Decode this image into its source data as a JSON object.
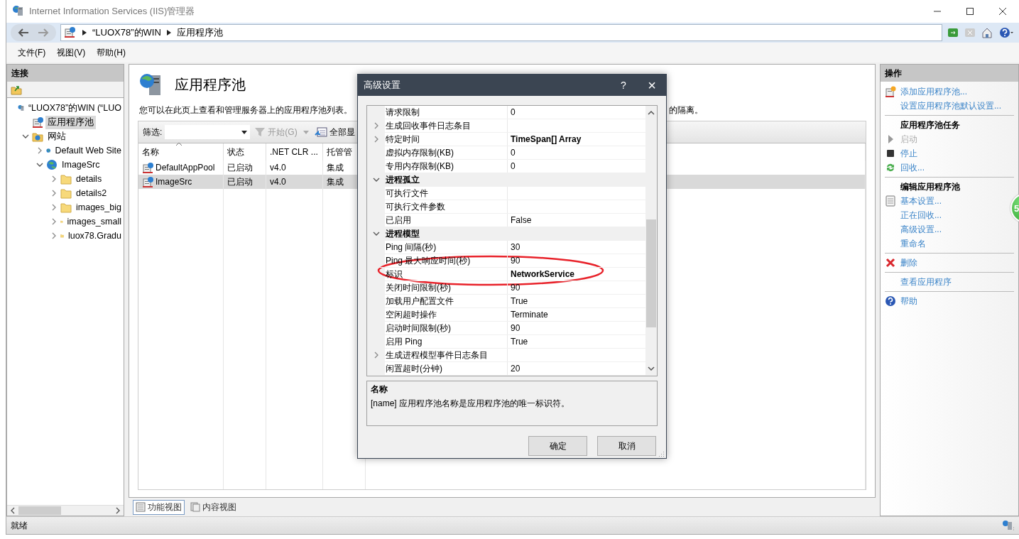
{
  "window": {
    "title": "Internet Information Services (IIS)管理器"
  },
  "address_bar": {
    "crumbs": [
      "“LUOX78”的WIN",
      "应用程序池"
    ]
  },
  "menu": [
    "文件(F)",
    "视图(V)",
    "帮助(H)"
  ],
  "connections": {
    "title": "连接",
    "tree": [
      {
        "label": "“LUOX78”的WIN (“LUO",
        "kind": "server",
        "selected": false,
        "children": [
          {
            "label": "应用程序池",
            "kind": "pool",
            "selected": true
          },
          {
            "label": "网站",
            "kind": "sites",
            "selected": false,
            "expanded": true,
            "children": [
              {
                "label": "Default Web Site",
                "kind": "site",
                "selected": false,
                "expanded": false
              },
              {
                "label": "ImageSrc",
                "kind": "site",
                "selected": false,
                "expanded": true,
                "children": [
                  {
                    "label": "details",
                    "kind": "folder",
                    "selected": false,
                    "expanded": false
                  },
                  {
                    "label": "details2",
                    "kind": "folder",
                    "selected": false,
                    "expanded": false
                  },
                  {
                    "label": "images_big",
                    "kind": "folder",
                    "selected": false,
                    "expanded": false
                  },
                  {
                    "label": "images_small",
                    "kind": "folder",
                    "selected": false,
                    "expanded": false
                  },
                  {
                    "label": "luox78.Gradu",
                    "kind": "folder",
                    "selected": false,
                    "expanded": false
                  }
                ]
              }
            ]
          }
        ]
      }
    ]
  },
  "content": {
    "title": "应用程序池",
    "description": "您可以在此页上查看和管理服务器上的应用程序池列表。",
    "description_tail": "的隔离。",
    "filter": {
      "label": "筛选:",
      "go": "开始(G)",
      "show_all": "全部显"
    },
    "columns": [
      "名称",
      "状态",
      ".NET CLR ...",
      "托管管"
    ],
    "rows": [
      {
        "cells": [
          "DefaultAppPool",
          "已启动",
          "v4.0",
          "集成"
        ],
        "selected": false
      },
      {
        "cells": [
          "ImageSrc",
          "已启动",
          "v4.0",
          "集成"
        ],
        "selected": true
      }
    ],
    "views": [
      {
        "label": "功能视图",
        "selected": true
      },
      {
        "label": "内容视图",
        "selected": false
      }
    ]
  },
  "actions": {
    "title": "操作",
    "items": [
      {
        "kind": "add",
        "text": "添加应用程序池...",
        "disabled": false
      },
      {
        "kind": "link",
        "text": "设置应用程序池默认设置...",
        "disabled": false
      },
      {
        "kind": "separator"
      },
      {
        "kind": "heading",
        "text": "应用程序池任务"
      },
      {
        "kind": "start",
        "text": "启动",
        "disabled": true
      },
      {
        "kind": "stop",
        "text": "停止",
        "disabled": false
      },
      {
        "kind": "recycle",
        "text": "回收...",
        "disabled": false
      },
      {
        "kind": "separator"
      },
      {
        "kind": "heading",
        "text": "编辑应用程序池"
      },
      {
        "kind": "edit",
        "text": "基本设置...",
        "disabled": false
      },
      {
        "kind": "link",
        "text": "正在回收...",
        "disabled": false
      },
      {
        "kind": "link",
        "text": "高级设置...",
        "disabled": false
      },
      {
        "kind": "link",
        "text": "重命名",
        "disabled": false
      },
      {
        "kind": "separator"
      },
      {
        "kind": "delete",
        "text": "删除",
        "disabled": false
      },
      {
        "kind": "separator"
      },
      {
        "kind": "link",
        "text": "查看应用程序",
        "disabled": false
      },
      {
        "kind": "separator"
      },
      {
        "kind": "help",
        "text": "帮助",
        "disabled": false
      }
    ]
  },
  "badge": {
    "text": "5"
  },
  "status_bar": {
    "text": "就绪"
  },
  "dialog": {
    "title": "高级设置",
    "help": "?",
    "close": "×",
    "properties": [
      {
        "kind": "prop",
        "name": "请求限制",
        "value": "0",
        "bold": false
      },
      {
        "kind": "prop",
        "name": "生成回收事件日志条目",
        "expanded": false
      },
      {
        "kind": "prop",
        "name": "特定时间",
        "value": "TimeSpan[] Array",
        "expanded": false,
        "bold": true
      },
      {
        "kind": "prop",
        "name": "虚拟内存限制(KB)",
        "value": "0",
        "bold": false
      },
      {
        "kind": "prop",
        "name": "专用内存限制(KB)",
        "value": "0",
        "bold": false
      },
      {
        "kind": "category",
        "name": "进程孤立",
        "expanded": true
      },
      {
        "kind": "prop",
        "name": "可执行文件"
      },
      {
        "kind": "prop",
        "name": "可执行文件参数"
      },
      {
        "kind": "prop",
        "name": "已启用",
        "value": "False",
        "bold": false
      },
      {
        "kind": "category",
        "name": "进程模型",
        "expanded": true
      },
      {
        "kind": "prop",
        "name": "Ping 间隔(秒)",
        "value": "30",
        "bold": false
      },
      {
        "kind": "prop",
        "name": "Ping 最大响应时间(秒)",
        "value": "90",
        "bold": false
      },
      {
        "kind": "prop",
        "name": "标识",
        "value": "NetworkService",
        "bold": true
      },
      {
        "kind": "prop",
        "name": "关闭时间限制(秒)",
        "value": "90",
        "bold": false
      },
      {
        "kind": "prop",
        "name": "加载用户配置文件",
        "value": "True",
        "bold": false
      },
      {
        "kind": "prop",
        "name": "空闲超时操作",
        "value": "Terminate",
        "bold": false
      },
      {
        "kind": "prop",
        "name": "启动时间限制(秒)",
        "value": "90",
        "bold": false
      },
      {
        "kind": "prop",
        "name": "启用 Ping",
        "value": "True",
        "bold": false
      },
      {
        "kind": "prop",
        "name": "生成进程模型事件日志条目",
        "expanded": false
      },
      {
        "kind": "prop",
        "name": "闲置超时(分钟)",
        "value": "20",
        "bold": false
      }
    ],
    "help_box": {
      "title": "名称",
      "text": "[name] 应用程序池名称是应用程序池的唯一标识符。"
    },
    "buttons": [
      "确定",
      "取消"
    ]
  }
}
